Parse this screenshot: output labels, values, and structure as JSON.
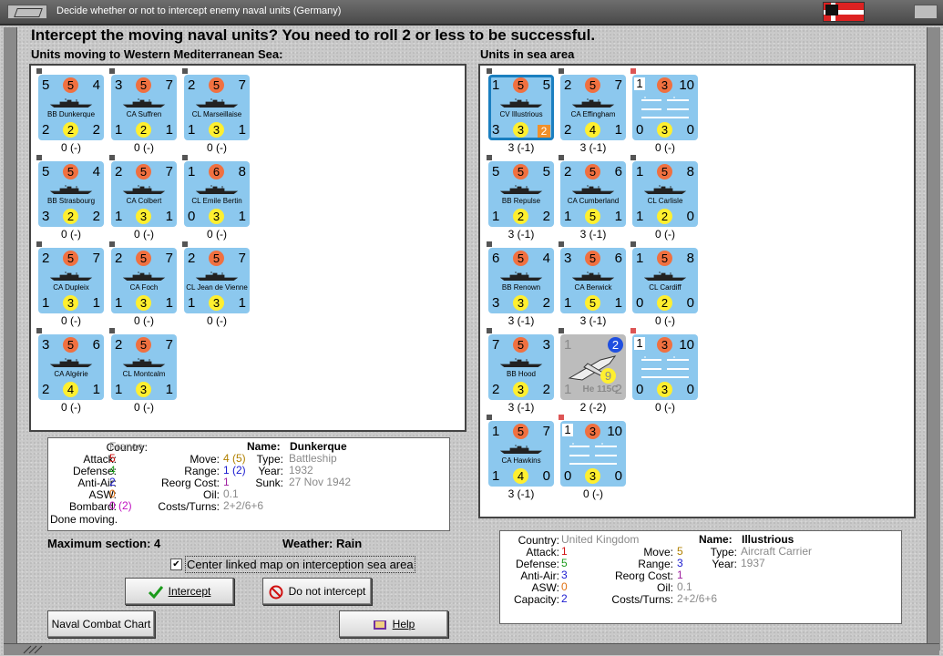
{
  "window": {
    "title": "Decide whether or not to intercept enemy naval units (Germany)"
  },
  "heading": "Intercept the moving naval units?  You need to roll 2 or less to be successful.",
  "left_panel": {
    "title": "Units moving to Western Mediterranean Sea:",
    "units": [
      {
        "tl": "5",
        "circle_top": "5",
        "tr": "4",
        "name": "BB Dunkerque",
        "bl": "2",
        "circle_bot": "2",
        "br": "2",
        "loss": "0 (-)"
      },
      {
        "tl": "3",
        "circle_top": "5",
        "tr": "7",
        "name": "CA Suffren",
        "bl": "1",
        "circle_bot": "2",
        "br": "1",
        "loss": "0 (-)"
      },
      {
        "tl": "2",
        "circle_top": "5",
        "tr": "7",
        "name": "CL Marseillaise",
        "bl": "1",
        "circle_bot": "3",
        "br": "1",
        "loss": "0 (-)"
      },
      {
        "tl": "5",
        "circle_top": "5",
        "tr": "4",
        "name": "BB Strasbourg",
        "bl": "3",
        "circle_bot": "2",
        "br": "2",
        "loss": "0 (-)"
      },
      {
        "tl": "2",
        "circle_top": "5",
        "tr": "7",
        "name": "CA Colbert",
        "bl": "1",
        "circle_bot": "3",
        "br": "1",
        "loss": "0 (-)"
      },
      {
        "tl": "1",
        "circle_top": "6",
        "tr": "8",
        "name": "CL Emile Bertin",
        "bl": "0",
        "circle_bot": "3",
        "br": "1",
        "loss": "0 (-)"
      },
      {
        "tl": "2",
        "circle_top": "5",
        "tr": "7",
        "name": "CA Dupleix",
        "bl": "1",
        "circle_bot": "3",
        "br": "1",
        "loss": "0 (-)"
      },
      {
        "tl": "2",
        "circle_top": "5",
        "tr": "7",
        "name": "CA Foch",
        "bl": "1",
        "circle_bot": "3",
        "br": "1",
        "loss": "0 (-)"
      },
      {
        "tl": "2",
        "circle_top": "5",
        "tr": "7",
        "name": "CL Jean de Vienne",
        "bl": "1",
        "circle_bot": "3",
        "br": "1",
        "loss": "0 (-)"
      },
      {
        "tl": "3",
        "circle_top": "5",
        "tr": "6",
        "name": "CA Algérie",
        "bl": "2",
        "circle_bot": "4",
        "br": "1",
        "loss": "0 (-)"
      },
      {
        "tl": "2",
        "circle_top": "5",
        "tr": "7",
        "name": "CL Montcalm",
        "bl": "1",
        "circle_bot": "3",
        "br": "1",
        "loss": "0 (-)"
      }
    ]
  },
  "right_panel": {
    "title": "Units in sea area",
    "units": [
      {
        "tl": "1",
        "circle_top": "5",
        "tr": "5",
        "name": "CV Illustrious",
        "bl": "3",
        "circle_bot": "3",
        "br": "2",
        "loss": "3 (-1)"
      },
      {
        "tl": "2",
        "circle_top": "5",
        "tr": "7",
        "name": "CA Effingham",
        "bl": "2",
        "circle_bot": "4",
        "br": "1",
        "loss": "3 (-1)"
      },
      {
        "tl": "1",
        "circle_top": "3",
        "tr": "10",
        "name": "",
        "bl": "0",
        "circle_bot": "3",
        "br": "0",
        "loss": "0 (-)"
      },
      {
        "tl": "5",
        "circle_top": "5",
        "tr": "5",
        "name": "BB Repulse",
        "bl": "1",
        "circle_bot": "2",
        "br": "2",
        "loss": "3 (-1)"
      },
      {
        "tl": "2",
        "circle_top": "5",
        "tr": "6",
        "name": "CA Cumberland",
        "bl": "1",
        "circle_bot": "5",
        "br": "1",
        "loss": "3 (-1)"
      },
      {
        "tl": "1",
        "circle_top": "5",
        "tr": "8",
        "name": "CL Carlisle",
        "bl": "1",
        "circle_bot": "2",
        "br": "0",
        "loss": "0 (-)"
      },
      {
        "tl": "6",
        "circle_top": "5",
        "tr": "4",
        "name": "BB Renown",
        "bl": "3",
        "circle_bot": "3",
        "br": "2",
        "loss": "3 (-1)"
      },
      {
        "tl": "3",
        "circle_top": "5",
        "tr": "6",
        "name": "CA Berwick",
        "bl": "1",
        "circle_bot": "5",
        "br": "1",
        "loss": "3 (-1)"
      },
      {
        "tl": "1",
        "circle_top": "5",
        "tr": "8",
        "name": "CL Cardiff",
        "bl": "0",
        "circle_bot": "2",
        "br": "0",
        "loss": "0 (-)"
      },
      {
        "tl": "7",
        "circle_top": "5",
        "tr": "3",
        "name": "BB Hood",
        "bl": "2",
        "circle_bot": "3",
        "br": "2",
        "loss": "3 (-1)"
      },
      {
        "tl": "1",
        "circle_top": "2",
        "tr": "",
        "name": "He 115C",
        "bl": "1",
        "circle_bot": "9",
        "br": "2",
        "loss": "2 (-2)"
      },
      {
        "tl": "1",
        "circle_top": "3",
        "tr": "10",
        "name": "",
        "bl": "0",
        "circle_bot": "3",
        "br": "0",
        "loss": "0 (-)"
      },
      {
        "tl": "1",
        "circle_top": "5",
        "tr": "7",
        "name": "CA Hawkins",
        "bl": "1",
        "circle_bot": "4",
        "br": "0",
        "loss": "3 (-1)"
      },
      {
        "tl": "1",
        "circle_top": "3",
        "tr": "10",
        "name": "",
        "bl": "0",
        "circle_bot": "3",
        "br": "0",
        "loss": "0 (-)"
      }
    ]
  },
  "left_info": {
    "country_label": "Country:",
    "country": "France",
    "attack_label": "Attack:",
    "attack": "5",
    "defense_label": "Defense:",
    "defense": "4",
    "antiair_label": "Anti-Air:",
    "antiair": "2",
    "asw_label": "ASW:",
    "asw": "0",
    "bombard_label": "Bombard:",
    "bombard": "0 (2)",
    "move_label": "Move:",
    "move": "4 (5)",
    "range_label": "Range:",
    "range": "1 (2)",
    "reorg_label": "Reorg Cost:",
    "reorg": "1",
    "oil_label": "Oil:",
    "oil": "0.1",
    "costs_label": "Costs/Turns:",
    "costs": "2+2/6+6",
    "name_label": "Name:",
    "name": "Dunkerque",
    "type_label": "Type:",
    "type": "Battleship",
    "year_label": "Year:",
    "year": "1932",
    "sunk_label": "Sunk:",
    "sunk": "27 Nov 1942",
    "status": "Done moving."
  },
  "right_info": {
    "country_label": "Country:",
    "country": "United Kingdom",
    "attack_label": "Attack:",
    "attack": "1",
    "defense_label": "Defense:",
    "defense": "5",
    "antiair_label": "Anti-Air:",
    "antiair": "3",
    "asw_label": "ASW:",
    "asw": "0",
    "capacity_label": "Capacity:",
    "capacity": "2",
    "move_label": "Move:",
    "move": "5",
    "range_label": "Range:",
    "range": "3",
    "reorg_label": "Reorg Cost:",
    "reorg": "1",
    "oil_label": "Oil:",
    "oil": "0.1",
    "costs_label": "Costs/Turns:",
    "costs": "2+2/6+6",
    "name_label": "Name:",
    "name": "Illustrious",
    "type_label": "Type:",
    "type": "Aircraft Carrier",
    "year_label": "Year:",
    "year": "1937"
  },
  "max_section": "Maximum section: 4",
  "weather": "Weather:  Rain",
  "checkbox_label": "Center linked map on interception sea area",
  "buttons": {
    "intercept": "Intercept",
    "do_not_intercept": "Do not intercept",
    "naval_chart": "Naval Combat Chart",
    "help": "Help"
  },
  "colors": {
    "counter_blue": "#8cc8ee",
    "attack_orange": "#f07040",
    "defense_yellow": "#ffef30"
  }
}
